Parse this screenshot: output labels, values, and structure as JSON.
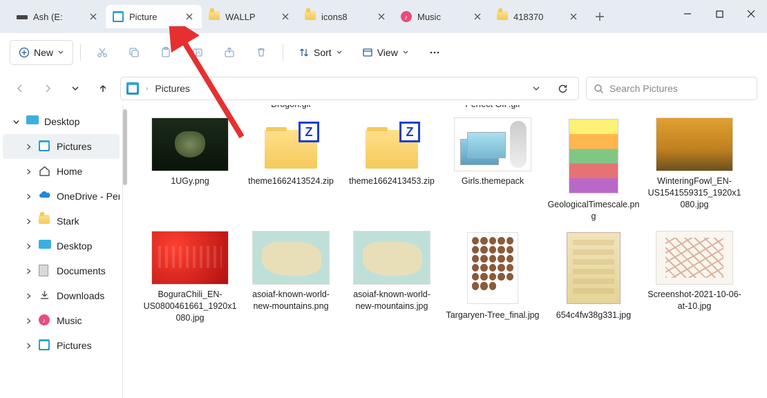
{
  "tabs": [
    {
      "label": "Ash (E:",
      "icon": "disk"
    },
    {
      "label": "Picture",
      "icon": "picture",
      "active": true
    },
    {
      "label": "WALLP",
      "icon": "folder"
    },
    {
      "label": "icons8",
      "icon": "folder"
    },
    {
      "label": "Music",
      "icon": "music"
    },
    {
      "label": "418370",
      "icon": "folder"
    }
  ],
  "toolbar": {
    "new_label": "New",
    "sort_label": "Sort",
    "view_label": "View"
  },
  "breadcrumb": {
    "label": "Pictures"
  },
  "search": {
    "placeholder": "Search Pictures"
  },
  "sidebar": [
    {
      "label": "Desktop",
      "icon": "desktop",
      "expanded": true,
      "indent": 0
    },
    {
      "label": "Pictures",
      "icon": "picture",
      "selected": true,
      "indent": 1
    },
    {
      "label": "Home",
      "icon": "home",
      "indent": 1
    },
    {
      "label": "OneDrive - Per",
      "icon": "onedrive",
      "indent": 1
    },
    {
      "label": "Stark",
      "icon": "folder",
      "indent": 1
    },
    {
      "label": "Desktop",
      "icon": "desktop-blue",
      "indent": 1
    },
    {
      "label": "Documents",
      "icon": "documents",
      "indent": 1
    },
    {
      "label": "Downloads",
      "icon": "downloads",
      "indent": 1
    },
    {
      "label": "Music",
      "icon": "music",
      "indent": 1
    },
    {
      "label": "Pictures",
      "icon": "picture",
      "indent": 1
    }
  ],
  "truncated_row": [
    "",
    "Drogon.gif",
    "",
    "Perfect GIF.gif",
    "",
    ""
  ],
  "files_row1": [
    {
      "name": "1UGy.png",
      "thumb": "yoda"
    },
    {
      "name": "theme1662413524.zip",
      "thumb": "zip"
    },
    {
      "name": "theme1662413453.zip",
      "thumb": "zip"
    },
    {
      "name": "Girls.themepack",
      "thumb": "themepack"
    },
    {
      "name": "GeologicalTimescale.png",
      "thumb": "geo"
    },
    {
      "name": "WinteringFowl_EN-US1541559315_1920x1080.jpg",
      "thumb": "fowl"
    }
  ],
  "files_row2": [
    {
      "name": "BoguraChili_EN-US0800461661_1920x1080.jpg",
      "thumb": "chili"
    },
    {
      "name": "asoiaf-known-world-new-mountains.png",
      "thumb": "map"
    },
    {
      "name": "asoiaf-known-world-new-mountains.jpg",
      "thumb": "map"
    },
    {
      "name": "Targaryen-Tree_final.jpg",
      "thumb": "tree"
    },
    {
      "name": "654c4fw38g331.jpg",
      "thumb": "scroll"
    },
    {
      "name": "Screenshot-2021-10-06-at-10.jpg",
      "thumb": "sketch"
    }
  ]
}
